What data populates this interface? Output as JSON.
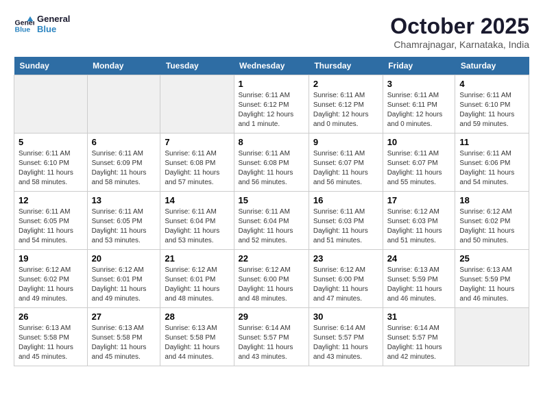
{
  "header": {
    "logo_line1": "General",
    "logo_line2": "Blue",
    "month": "October 2025",
    "location": "Chamrajnagar, Karnataka, India"
  },
  "days_of_week": [
    "Sunday",
    "Monday",
    "Tuesday",
    "Wednesday",
    "Thursday",
    "Friday",
    "Saturday"
  ],
  "weeks": [
    [
      {
        "day": "",
        "info": ""
      },
      {
        "day": "",
        "info": ""
      },
      {
        "day": "",
        "info": ""
      },
      {
        "day": "1",
        "info": "Sunrise: 6:11 AM\nSunset: 6:12 PM\nDaylight: 12 hours\nand 1 minute."
      },
      {
        "day": "2",
        "info": "Sunrise: 6:11 AM\nSunset: 6:12 PM\nDaylight: 12 hours\nand 0 minutes."
      },
      {
        "day": "3",
        "info": "Sunrise: 6:11 AM\nSunset: 6:11 PM\nDaylight: 12 hours\nand 0 minutes."
      },
      {
        "day": "4",
        "info": "Sunrise: 6:11 AM\nSunset: 6:10 PM\nDaylight: 11 hours\nand 59 minutes."
      }
    ],
    [
      {
        "day": "5",
        "info": "Sunrise: 6:11 AM\nSunset: 6:10 PM\nDaylight: 11 hours\nand 58 minutes."
      },
      {
        "day": "6",
        "info": "Sunrise: 6:11 AM\nSunset: 6:09 PM\nDaylight: 11 hours\nand 58 minutes."
      },
      {
        "day": "7",
        "info": "Sunrise: 6:11 AM\nSunset: 6:08 PM\nDaylight: 11 hours\nand 57 minutes."
      },
      {
        "day": "8",
        "info": "Sunrise: 6:11 AM\nSunset: 6:08 PM\nDaylight: 11 hours\nand 56 minutes."
      },
      {
        "day": "9",
        "info": "Sunrise: 6:11 AM\nSunset: 6:07 PM\nDaylight: 11 hours\nand 56 minutes."
      },
      {
        "day": "10",
        "info": "Sunrise: 6:11 AM\nSunset: 6:07 PM\nDaylight: 11 hours\nand 55 minutes."
      },
      {
        "day": "11",
        "info": "Sunrise: 6:11 AM\nSunset: 6:06 PM\nDaylight: 11 hours\nand 54 minutes."
      }
    ],
    [
      {
        "day": "12",
        "info": "Sunrise: 6:11 AM\nSunset: 6:05 PM\nDaylight: 11 hours\nand 54 minutes."
      },
      {
        "day": "13",
        "info": "Sunrise: 6:11 AM\nSunset: 6:05 PM\nDaylight: 11 hours\nand 53 minutes."
      },
      {
        "day": "14",
        "info": "Sunrise: 6:11 AM\nSunset: 6:04 PM\nDaylight: 11 hours\nand 53 minutes."
      },
      {
        "day": "15",
        "info": "Sunrise: 6:11 AM\nSunset: 6:04 PM\nDaylight: 11 hours\nand 52 minutes."
      },
      {
        "day": "16",
        "info": "Sunrise: 6:11 AM\nSunset: 6:03 PM\nDaylight: 11 hours\nand 51 minutes."
      },
      {
        "day": "17",
        "info": "Sunrise: 6:12 AM\nSunset: 6:03 PM\nDaylight: 11 hours\nand 51 minutes."
      },
      {
        "day": "18",
        "info": "Sunrise: 6:12 AM\nSunset: 6:02 PM\nDaylight: 11 hours\nand 50 minutes."
      }
    ],
    [
      {
        "day": "19",
        "info": "Sunrise: 6:12 AM\nSunset: 6:02 PM\nDaylight: 11 hours\nand 49 minutes."
      },
      {
        "day": "20",
        "info": "Sunrise: 6:12 AM\nSunset: 6:01 PM\nDaylight: 11 hours\nand 49 minutes."
      },
      {
        "day": "21",
        "info": "Sunrise: 6:12 AM\nSunset: 6:01 PM\nDaylight: 11 hours\nand 48 minutes."
      },
      {
        "day": "22",
        "info": "Sunrise: 6:12 AM\nSunset: 6:00 PM\nDaylight: 11 hours\nand 48 minutes."
      },
      {
        "day": "23",
        "info": "Sunrise: 6:12 AM\nSunset: 6:00 PM\nDaylight: 11 hours\nand 47 minutes."
      },
      {
        "day": "24",
        "info": "Sunrise: 6:13 AM\nSunset: 5:59 PM\nDaylight: 11 hours\nand 46 minutes."
      },
      {
        "day": "25",
        "info": "Sunrise: 6:13 AM\nSunset: 5:59 PM\nDaylight: 11 hours\nand 46 minutes."
      }
    ],
    [
      {
        "day": "26",
        "info": "Sunrise: 6:13 AM\nSunset: 5:58 PM\nDaylight: 11 hours\nand 45 minutes."
      },
      {
        "day": "27",
        "info": "Sunrise: 6:13 AM\nSunset: 5:58 PM\nDaylight: 11 hours\nand 45 minutes."
      },
      {
        "day": "28",
        "info": "Sunrise: 6:13 AM\nSunset: 5:58 PM\nDaylight: 11 hours\nand 44 minutes."
      },
      {
        "day": "29",
        "info": "Sunrise: 6:14 AM\nSunset: 5:57 PM\nDaylight: 11 hours\nand 43 minutes."
      },
      {
        "day": "30",
        "info": "Sunrise: 6:14 AM\nSunset: 5:57 PM\nDaylight: 11 hours\nand 43 minutes."
      },
      {
        "day": "31",
        "info": "Sunrise: 6:14 AM\nSunset: 5:57 PM\nDaylight: 11 hours\nand 42 minutes."
      },
      {
        "day": "",
        "info": ""
      }
    ]
  ]
}
